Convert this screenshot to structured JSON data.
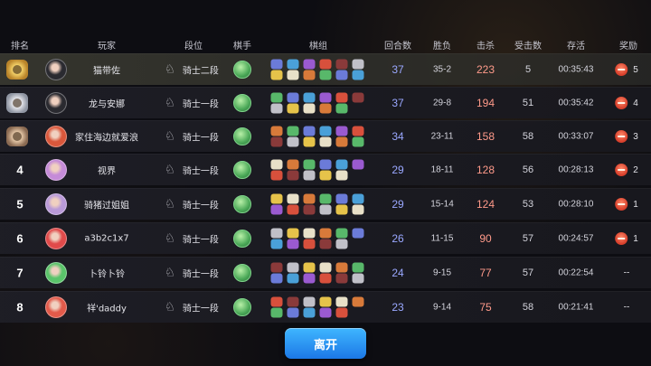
{
  "header": {
    "rank": "排名",
    "player": "玩家",
    "tier": "段位",
    "chess_player": "棋手",
    "lineup": "棋组",
    "rounds": "回合数",
    "record": "胜负",
    "kills": "击杀",
    "damage_taken": "受击数",
    "survival": "存活",
    "reward": "奖励"
  },
  "rows": [
    {
      "rank": "",
      "rank_icon": "gold-medal-icon",
      "name": "猫带佐",
      "tier": "骑士二段",
      "rounds": "37",
      "record": "35-2",
      "kills": "223",
      "damage_taken": "5",
      "survival": "00:35:43",
      "reward": "5",
      "avatar_color": "#2a2a30"
    },
    {
      "rank": "",
      "rank_icon": "silver-medal-icon",
      "name": "龙与安娜",
      "tier": "骑士一段",
      "rounds": "37",
      "record": "29-8",
      "kills": "194",
      "damage_taken": "51",
      "survival": "00:35:42",
      "reward": "4",
      "avatar_color": "#2a2a30"
    },
    {
      "rank": "",
      "rank_icon": "bronze-medal-icon",
      "name": "家住海边就爱浪",
      "tier": "骑士一段",
      "rounds": "34",
      "record": "23-11",
      "kills": "158",
      "damage_taken": "58",
      "survival": "00:33:07",
      "reward": "3",
      "avatar_color": "#d9573b"
    },
    {
      "rank": "4",
      "rank_icon": "",
      "name": "视界",
      "tier": "骑士一段",
      "rounds": "29",
      "record": "18-11",
      "kills": "128",
      "damage_taken": "56",
      "survival": "00:28:13",
      "reward": "2",
      "avatar_color": "#c58bd8"
    },
    {
      "rank": "5",
      "rank_icon": "",
      "name": "骑猪过姐姐",
      "tier": "骑士一段",
      "rounds": "29",
      "record": "15-14",
      "kills": "124",
      "damage_taken": "53",
      "survival": "00:28:10",
      "reward": "1",
      "avatar_color": "#b99ad8"
    },
    {
      "rank": "6",
      "rank_icon": "",
      "name": "a3b2c1x7",
      "tier": "骑士一段",
      "rounds": "26",
      "record": "11-15",
      "kills": "90",
      "damage_taken": "57",
      "survival": "00:24:57",
      "reward": "1",
      "avatar_color": "#e04a4a"
    },
    {
      "rank": "7",
      "rank_icon": "",
      "name": "卜铃卜铃",
      "tier": "骑士一段",
      "rounds": "24",
      "record": "9-15",
      "kills": "77",
      "damage_taken": "57",
      "survival": "00:22:54",
      "reward": "--",
      "avatar_color": "#5ac46a"
    },
    {
      "rank": "8",
      "rank_icon": "",
      "name": "祥'daddy",
      "tier": "骑士一段",
      "rounds": "23",
      "record": "9-14",
      "kills": "75",
      "damage_taken": "58",
      "survival": "00:21:41",
      "reward": "--",
      "avatar_color": "#e25a4a"
    }
  ],
  "piece_colors": [
    "#6b7bd8",
    "#d8503c",
    "#e6c34a",
    "#58b86a",
    "#9a5ad0",
    "#c0c0c8",
    "#d87a3a",
    "#4aa0d8",
    "#8a3a3a",
    "#e8e0c8"
  ],
  "leave_button": "离开",
  "icons": {
    "tier": "knight-chess-icon",
    "reward": "candy-icon"
  }
}
